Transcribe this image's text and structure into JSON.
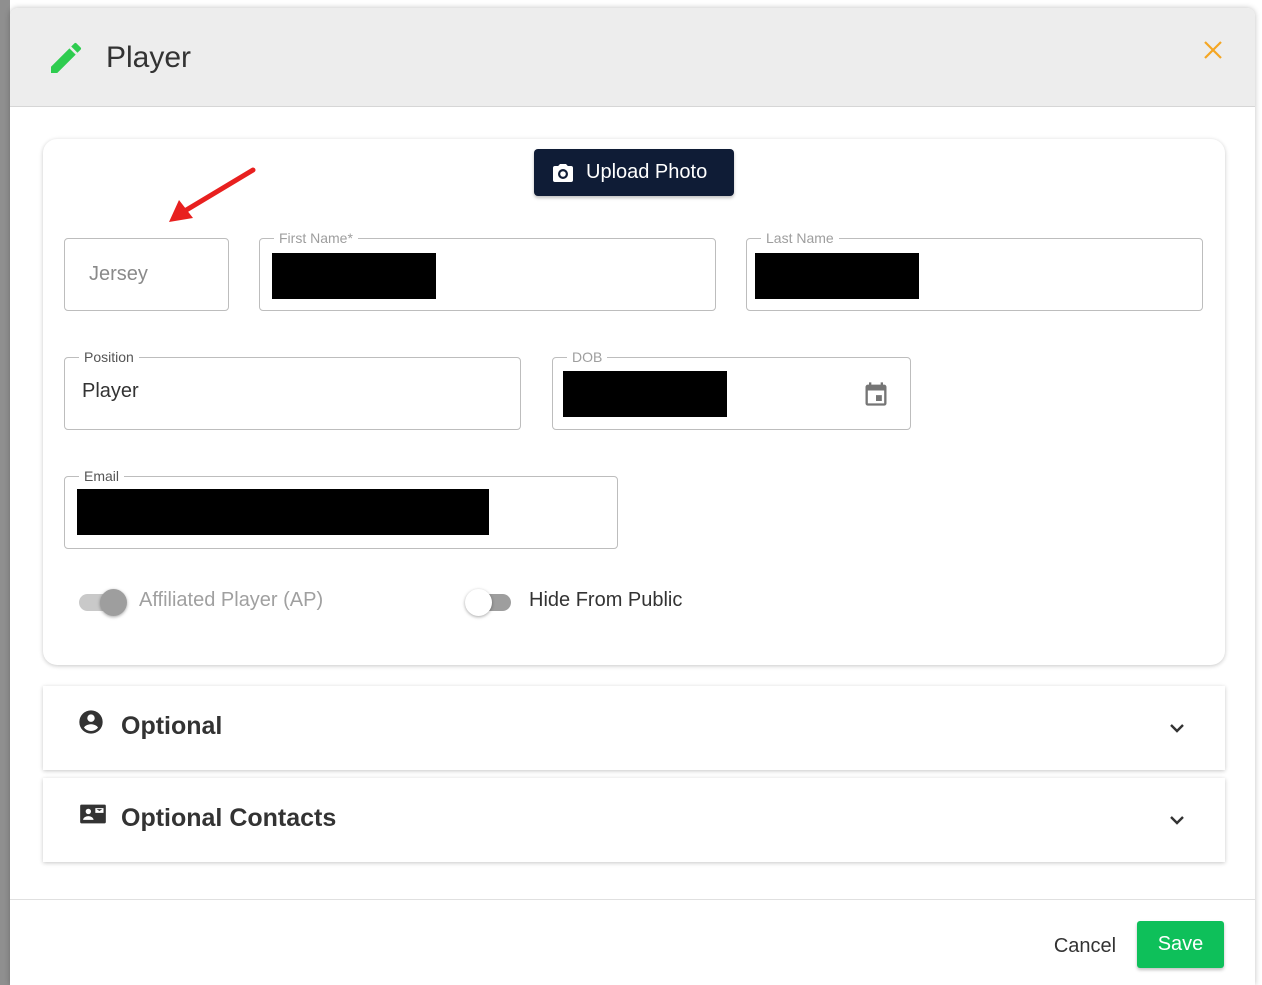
{
  "dialog": {
    "title": "Player",
    "icon": "pencil-icon",
    "close_icon": "close-icon",
    "accent_pencil": "#2ecc4f",
    "accent_close": "#f5a623"
  },
  "upload": {
    "label": "Upload Photo",
    "icon": "camera-icon"
  },
  "fields": {
    "jersey": {
      "placeholder": "Jersey",
      "value": ""
    },
    "first_name": {
      "label": "First Name*",
      "value_redacted": true
    },
    "last_name": {
      "label": "Last Name",
      "value_redacted": true
    },
    "position": {
      "label": "Position",
      "value": "Player"
    },
    "dob": {
      "label": "DOB",
      "value_redacted": true,
      "icon": "calendar-icon"
    },
    "email": {
      "label": "Email",
      "value_redacted": true
    }
  },
  "toggles": {
    "affiliated": {
      "label": "Affiliated Player (AP)",
      "checked": true,
      "disabled": true
    },
    "hide_public": {
      "label": "Hide From Public",
      "checked": false,
      "disabled": false
    }
  },
  "sections": [
    {
      "title": "Optional",
      "icon": "account-circle-icon"
    },
    {
      "title": "Optional Contacts",
      "icon": "contact-mail-icon"
    }
  ],
  "footer": {
    "cancel_label": "Cancel",
    "save_label": "Save",
    "save_color": "#0ec05a"
  }
}
